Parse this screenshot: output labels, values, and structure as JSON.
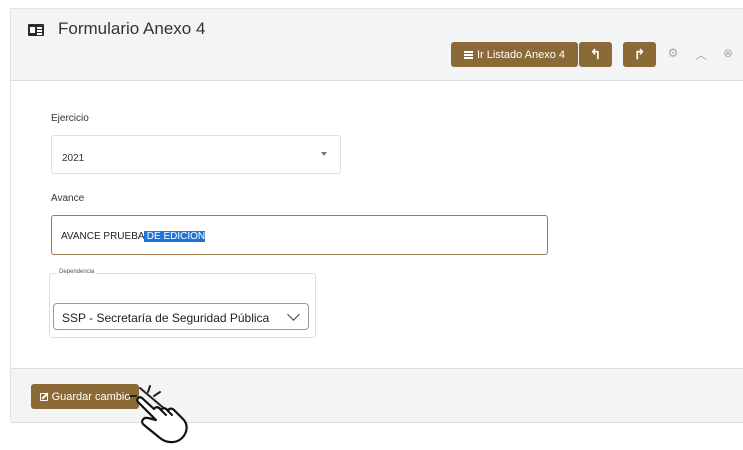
{
  "header": {
    "title": "Formulario Anexo 4",
    "title_icon": "id-card-icon",
    "list_button_label": "Ir Listado Anexo 4",
    "list_button_icon": "list-icon",
    "undo_icon": "reply-icon",
    "undo_glyph": "↰",
    "redo_icon": "share-icon",
    "redo_glyph": "↱",
    "tools": {
      "settings_icon": "gear-icon",
      "settings_glyph": "⚙",
      "collapse_icon": "chevron-up-icon",
      "collapse_glyph": "︿",
      "close_icon": "close-circle-icon",
      "close_glyph": "⊗"
    }
  },
  "form": {
    "ejercicio": {
      "label": "Ejercicio",
      "selected": "2021"
    },
    "avance": {
      "label": "Avance",
      "value_plain": "AVANCE PRUEBA",
      "value_selected": " DE EDICIÓN"
    },
    "dependencia": {
      "legend": "Dependencia",
      "selected": "SSP - Secretaría de Seguridad Pública"
    }
  },
  "footer": {
    "save_label": "Guardar cambio",
    "save_icon": "edit-icon"
  },
  "cursor_icon": "hand-pointer-icon",
  "colors": {
    "brand_button": "#8b6a37",
    "header_bg": "#f3f4f5",
    "selection": "#1f75d6",
    "input_focus_border": "#9c7950"
  }
}
